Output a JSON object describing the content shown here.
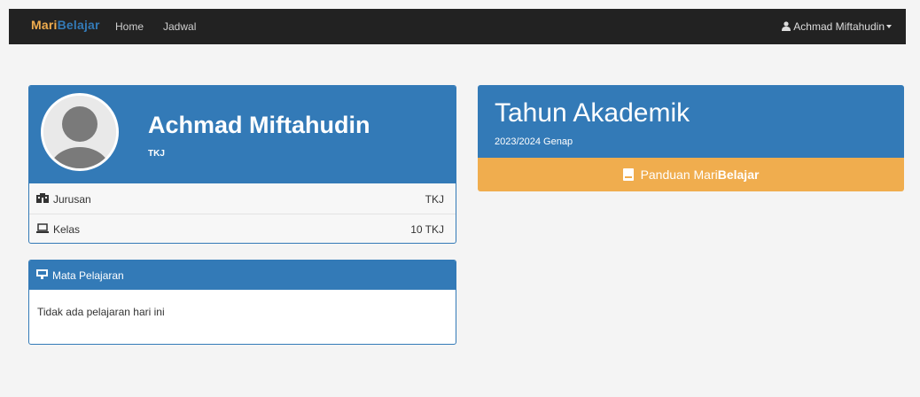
{
  "navbar": {
    "brand_part1": "Mari",
    "brand_part2": "Belajar",
    "links": [
      "Home",
      "Jadwal"
    ],
    "user_name": "Achmad Miftahudin"
  },
  "profile": {
    "name": "Achmad Miftahudin",
    "subtitle": "TKJ",
    "rows": [
      {
        "label": "Jurusan",
        "value": "TKJ",
        "icon": "building-icon"
      },
      {
        "label": "Kelas",
        "value": "10 TKJ",
        "icon": "laptop-icon"
      }
    ]
  },
  "subjects": {
    "title": "Mata Pelajaran",
    "empty_text": "Tidak ada pelajaran hari ini",
    "icon": "chalkboard-icon"
  },
  "academic": {
    "title": "Tahun Akademik",
    "period": "2023/2024 Genap",
    "guide_prefix": "Panduan Mari",
    "guide_bold": "Belajar",
    "icon": "book-icon"
  },
  "colors": {
    "primary": "#337ab7",
    "warning": "#f0ad4e",
    "navbar": "#222222",
    "background": "#f4f4f4"
  }
}
